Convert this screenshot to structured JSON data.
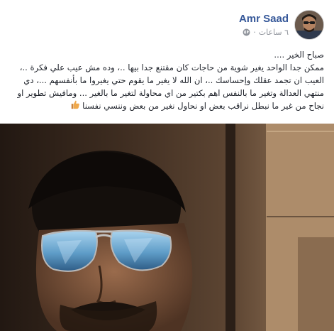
{
  "post": {
    "author_name": "Amr Saad",
    "timestamp": "٦ ساعات",
    "separator": "·",
    "privacy_icon": "globe-icon",
    "lines": [
      "صباح الخير ....",
      "ممكن جدا الواحد يغير شوية من حاجات كان مقتنع جدا بيها ..، وده مش عيب علي فكرة ..،",
      "العيب ان تجمد عقلك وإحساسك ..، ان الله لا يغير ما يقوم حتي يغيروا ما بأنفسهم ...، دي",
      "منتهي العدالة وتغير ما بالنفس اهم بكتير من اي محاولة لتغير ما بالغير ... ومافيش تطوير او",
      "نجاح من غير ما نبطل نراقب بعض او نحاول نغير من بعض وننسي نفسنا"
    ],
    "emoji": "thumbs-up-icon"
  },
  "colors": {
    "author": "#365899",
    "meta": "#90949c",
    "text": "#1d2129"
  }
}
